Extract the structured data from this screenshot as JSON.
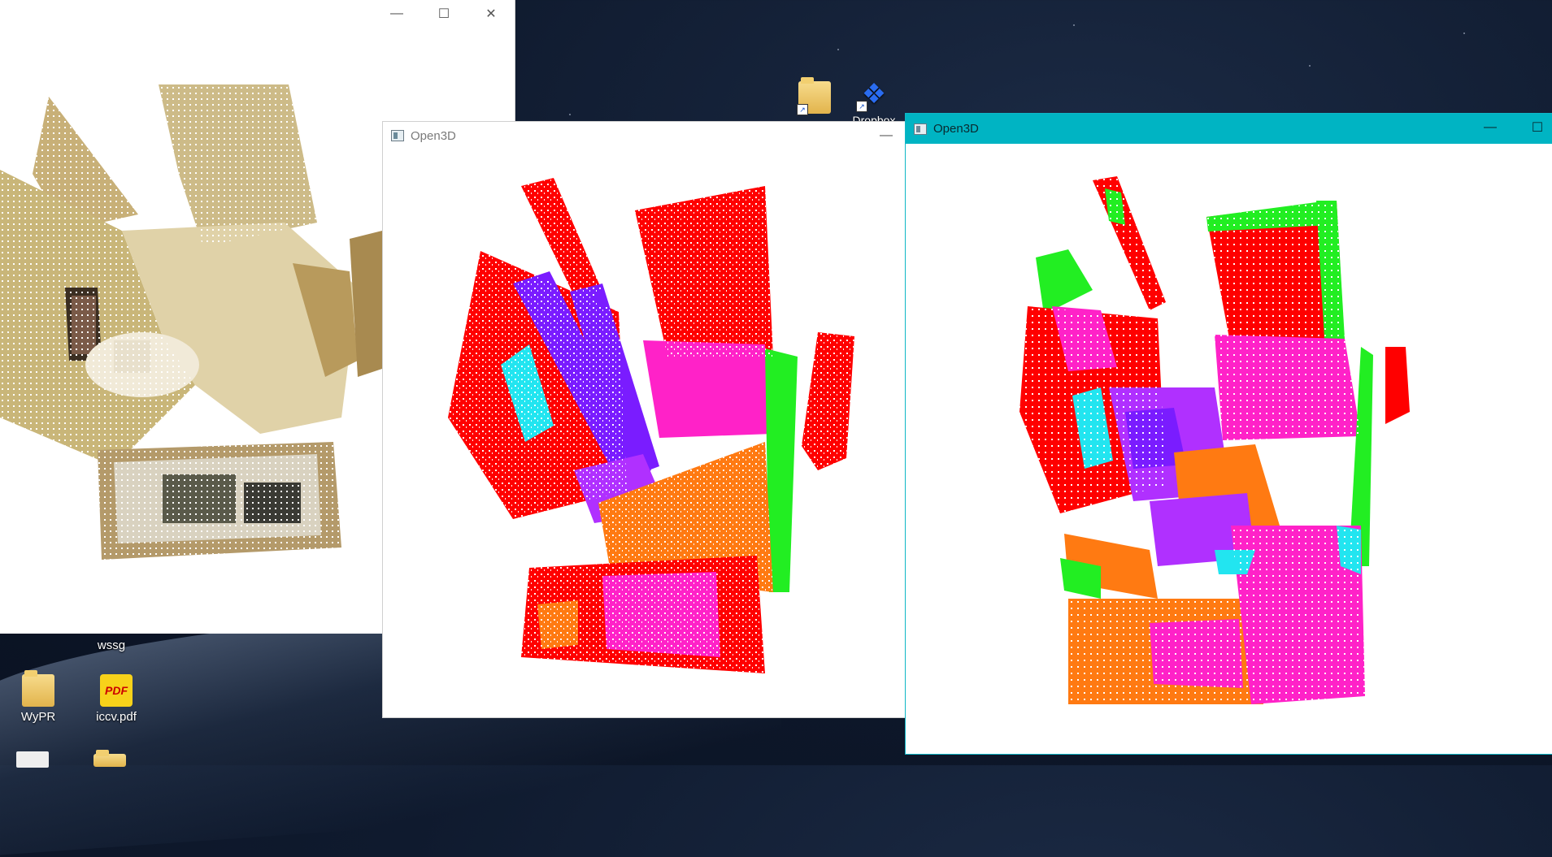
{
  "windows": [
    {
      "title": "",
      "controls": [
        "—",
        "☐",
        "✕"
      ]
    },
    {
      "title": "Open3D",
      "controls": [
        "—"
      ]
    },
    {
      "title": "Open3D",
      "controls": [
        "—",
        "☐"
      ]
    }
  ],
  "desktop_icons": [
    {
      "label": "wssg"
    },
    {
      "label": "WyPR"
    },
    {
      "label": "iccv.pdf"
    },
    {
      "label": "Dropbox"
    }
  ],
  "colors": {
    "titlebar_active": "#00b4c3",
    "segment_red": "#ff0000",
    "segment_purple": "#7a1cff",
    "segment_magenta": "#ff22c8",
    "segment_green": "#22ee22",
    "segment_cyan": "#22e5f0",
    "segment_orange": "#ff7a12",
    "segment_violet": "#b030ff"
  }
}
